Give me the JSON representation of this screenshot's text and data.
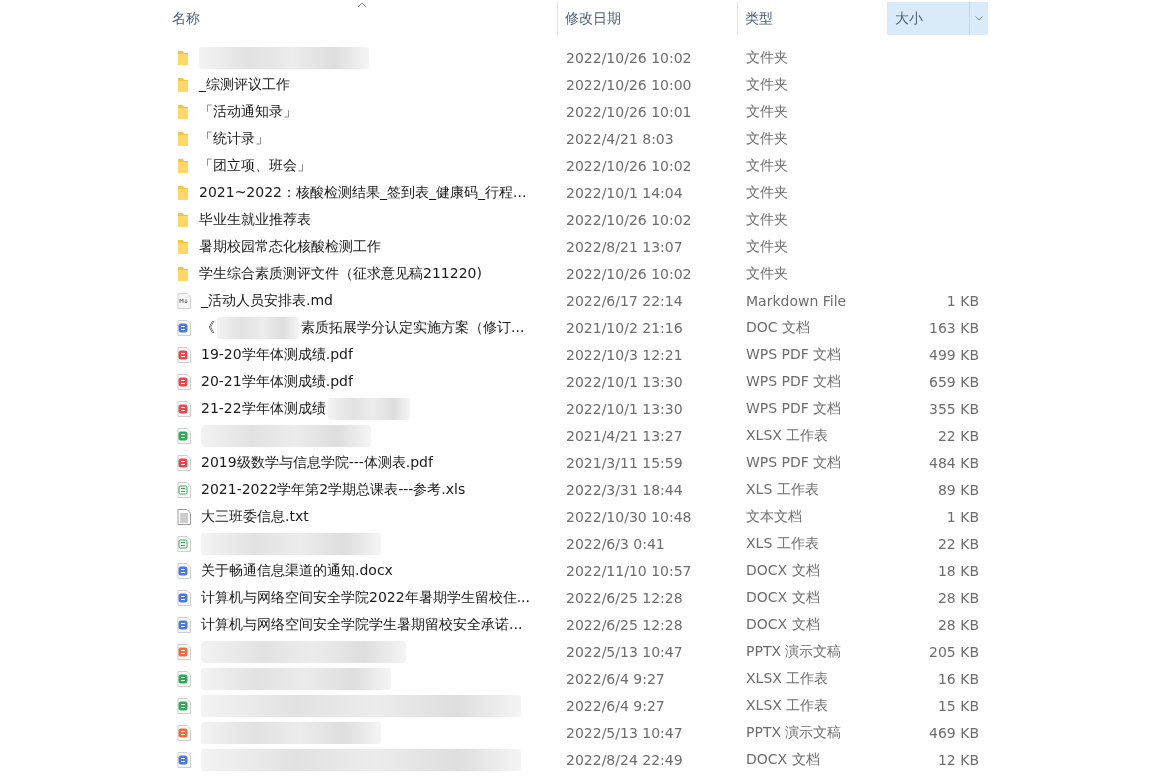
{
  "columns": [
    {
      "label": "名称",
      "sorted": true,
      "highlighted": false,
      "has_menu": false
    },
    {
      "label": "修改日期",
      "sorted": false,
      "highlighted": false,
      "has_menu": false
    },
    {
      "label": "类型",
      "sorted": false,
      "highlighted": false,
      "has_menu": false
    },
    {
      "label": "大小",
      "sorted": false,
      "highlighted": true,
      "has_menu": true
    }
  ],
  "rows": [
    {
      "kind": "folder",
      "name": [
        {
          "kind": "redacted"
        }
      ],
      "modified": "2022/10/26 10:02",
      "type": "文件夹"
    },
    {
      "kind": "folder",
      "name": [
        {
          "kind": "text",
          "text": "_综测评议工作"
        }
      ],
      "modified": "2022/10/26 10:00",
      "type": "文件夹"
    },
    {
      "kind": "folder",
      "name": [
        {
          "kind": "text",
          "text": "「活动通知录」"
        }
      ],
      "modified": "2022/10/26 10:01",
      "type": "文件夹"
    },
    {
      "kind": "folder",
      "name": [
        {
          "kind": "text",
          "text": "「统计录」"
        }
      ],
      "modified": "2022/4/21 8:03",
      "type": "文件夹"
    },
    {
      "kind": "folder",
      "name": [
        {
          "kind": "text",
          "text": "「团立项、班会」"
        }
      ],
      "modified": "2022/10/26 10:02",
      "type": "文件夹"
    },
    {
      "kind": "folder",
      "name": [
        {
          "kind": "text",
          "text": "2021~2022：核酸检测结果_签到表_健康码_行程..."
        }
      ],
      "modified": "2022/10/1 14:04",
      "type": "文件夹"
    },
    {
      "kind": "folder",
      "name": [
        {
          "kind": "text",
          "text": "毕业生就业推荐表"
        }
      ],
      "modified": "2022/10/26 10:02",
      "type": "文件夹"
    },
    {
      "kind": "folder",
      "name": [
        {
          "kind": "text",
          "text": "暑期校园常态化核酸检测工作"
        }
      ],
      "modified": "2022/8/21 13:07",
      "type": "文件夹"
    },
    {
      "kind": "folder",
      "name": [
        {
          "kind": "text",
          "text": "学生综合素质测评文件（征求意见稿211220)"
        }
      ],
      "modified": "2022/10/26 10:02",
      "type": "文件夹"
    },
    {
      "kind": "markdown",
      "name": [
        {
          "kind": "text",
          "text": "_活动人员安排表.md"
        }
      ],
      "modified": "2022/6/17 22:14",
      "type": "Markdown File",
      "size": "1 KB"
    },
    {
      "kind": "word",
      "name": [
        {
          "kind": "text",
          "text": "《"
        },
        {
          "kind": "redacted"
        },
        {
          "kind": "text",
          "text": "素质拓展学分认定实施方案（修订..."
        }
      ],
      "modified": "2021/10/2 21:16",
      "type": "DOC 文档",
      "size": "163 KB"
    },
    {
      "kind": "pdf",
      "name": [
        {
          "kind": "text",
          "text": "19-20学年体测成绩.pdf"
        }
      ],
      "modified": "2022/10/3 12:21",
      "type": "WPS PDF 文档",
      "size": "499 KB"
    },
    {
      "kind": "pdf",
      "name": [
        {
          "kind": "text",
          "text": "20-21学年体测成绩.pdf"
        }
      ],
      "modified": "2022/10/1 13:30",
      "type": "WPS PDF 文档",
      "size": "659 KB"
    },
    {
      "kind": "pdf",
      "name": [
        {
          "kind": "text",
          "text": "21-22学年体测成绩"
        },
        {
          "kind": "redacted"
        }
      ],
      "modified": "2022/10/1 13:30",
      "type": "WPS PDF 文档",
      "size": "355 KB"
    },
    {
      "kind": "sheet",
      "name": [
        {
          "kind": "redacted"
        }
      ],
      "modified": "2021/4/21 13:27",
      "type": "XLSX 工作表",
      "size": "22 KB"
    },
    {
      "kind": "pdf",
      "name": [
        {
          "kind": "text",
          "text": "2019级数学与信息学院---体测表.pdf"
        }
      ],
      "modified": "2021/3/11 15:59",
      "type": "WPS PDF 文档",
      "size": "484 KB"
    },
    {
      "kind": "sheet-outline",
      "name": [
        {
          "kind": "text",
          "text": "2021-2022学年第2学期总课表---参考.xls"
        }
      ],
      "modified": "2022/3/31 18:44",
      "type": "XLS 工作表",
      "size": "89 KB"
    },
    {
      "kind": "text",
      "name": [
        {
          "kind": "text",
          "text": "大三班委信息.txt"
        }
      ],
      "modified": "2022/10/30 10:48",
      "type": "文本文档",
      "size": "1 KB"
    },
    {
      "kind": "sheet-outline",
      "name": [
        {
          "kind": "redacted"
        }
      ],
      "modified": "2022/6/3 0:41",
      "type": "XLS 工作表",
      "size": "22 KB"
    },
    {
      "kind": "word",
      "name": [
        {
          "kind": "text",
          "text": "关于畅通信息渠道的通知.docx"
        }
      ],
      "modified": "2022/11/10 10:57",
      "type": "DOCX 文档",
      "size": "18 KB"
    },
    {
      "kind": "word",
      "name": [
        {
          "kind": "text",
          "text": "计算机与网络空间安全学院2022年暑期学生留校住..."
        }
      ],
      "modified": "2022/6/25 12:28",
      "type": "DOCX 文档",
      "size": "28 KB"
    },
    {
      "kind": "word",
      "name": [
        {
          "kind": "text",
          "text": "计算机与网络空间安全学院学生暑期留校安全承诺..."
        }
      ],
      "modified": "2022/6/25 12:28",
      "type": "DOCX 文档",
      "size": "28 KB"
    },
    {
      "kind": "slides",
      "name": [
        {
          "kind": "redacted"
        }
      ],
      "modified": "2022/5/13 10:47",
      "type": "PPTX 演示文稿",
      "size": "205 KB"
    },
    {
      "kind": "sheet",
      "name": [
        {
          "kind": "redacted"
        }
      ],
      "modified": "2022/6/4 9:27",
      "type": "XLSX 工作表",
      "size": "16 KB"
    },
    {
      "kind": "sheet",
      "name": [
        {
          "kind": "redacted"
        }
      ],
      "modified": "2022/6/4 9:27",
      "type": "XLSX 工作表",
      "size": "15 KB"
    },
    {
      "kind": "slides",
      "name": [
        {
          "kind": "redacted"
        }
      ],
      "modified": "2022/5/13 10:47",
      "type": "PPTX 演示文稿",
      "size": "469 KB"
    },
    {
      "kind": "word",
      "name": [
        {
          "kind": "redacted"
        }
      ],
      "modified": "2022/8/24 22:49",
      "type": "DOCX 文档",
      "size": "12 KB"
    }
  ]
}
